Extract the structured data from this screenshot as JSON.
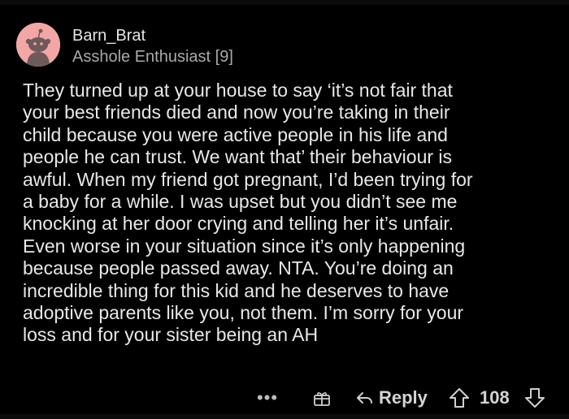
{
  "comment": {
    "username": "Barn_Brat",
    "flair": "Asshole Enthusiast [9]",
    "avatar_color": "#f3a6a6",
    "body_lines": [
      "They turned up at your house to say ‘it’s not fair that",
      "your best friends died and now you’re taking in their",
      "child because you were active people in his life and",
      "people he can trust. We want that’ their behaviour is",
      "awful. When my friend got pregnant, I’d been trying for",
      "a baby for a while. I was upset but you didn’t see me",
      "knocking at her door crying and telling her it’s unfair.",
      "Even worse in your situation since it’s only happening",
      "because people passed away. NTA. You’re doing an",
      "incredible thing for this kid and he deserves to have",
      "adoptive parents like you, not them. I’m sorry for your",
      "loss and for your sister being an AH"
    ]
  },
  "actions": {
    "more_label": "•••",
    "award_icon": "gift-icon",
    "reply_icon": "reply-arrow-icon",
    "reply_label": "Reply",
    "upvote_icon": "upvote-arrow-icon",
    "score": "108",
    "downvote_icon": "downvote-arrow-icon"
  },
  "colors": {
    "background": "#000000",
    "text": "#e8e8e8",
    "muted": "#a9a9a9"
  }
}
